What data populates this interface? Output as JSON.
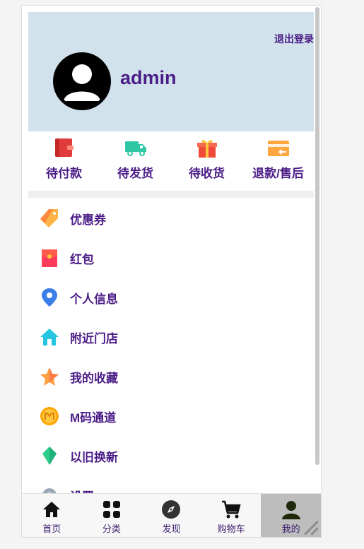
{
  "header": {
    "logout_label": "退出登录",
    "username": "admin"
  },
  "orders": [
    {
      "label": "待付款",
      "icon": "wallet-icon"
    },
    {
      "label": "待发货",
      "icon": "truck-icon"
    },
    {
      "label": "待收货",
      "icon": "gift-icon"
    },
    {
      "label": "退款/售后",
      "icon": "refund-card-icon"
    }
  ],
  "menu": [
    {
      "label": "优惠券",
      "icon": "coupon-tag-icon"
    },
    {
      "label": "红包",
      "icon": "red-envelope-icon"
    },
    {
      "label": "个人信息",
      "icon": "location-pin-icon"
    },
    {
      "label": "附近门店",
      "icon": "home-icon"
    },
    {
      "label": "我的收藏",
      "icon": "star-icon"
    },
    {
      "label": "M码通道",
      "icon": "m-coin-icon"
    },
    {
      "label": "以旧换新",
      "icon": "leaf-gem-icon"
    },
    {
      "label": "设置",
      "icon": "settings-icon"
    }
  ],
  "tabs": [
    {
      "label": "首页",
      "icon": "home-icon"
    },
    {
      "label": "分类",
      "icon": "grid-icon"
    },
    {
      "label": "发现",
      "icon": "compass-icon"
    },
    {
      "label": "购物车",
      "icon": "cart-icon"
    },
    {
      "label": "我的",
      "icon": "user-icon",
      "active": true
    }
  ],
  "colors": {
    "header_bg": "#d2e2ec",
    "text_purple": "#4b1d87",
    "active_tab_bg": "#bdbdbd"
  }
}
